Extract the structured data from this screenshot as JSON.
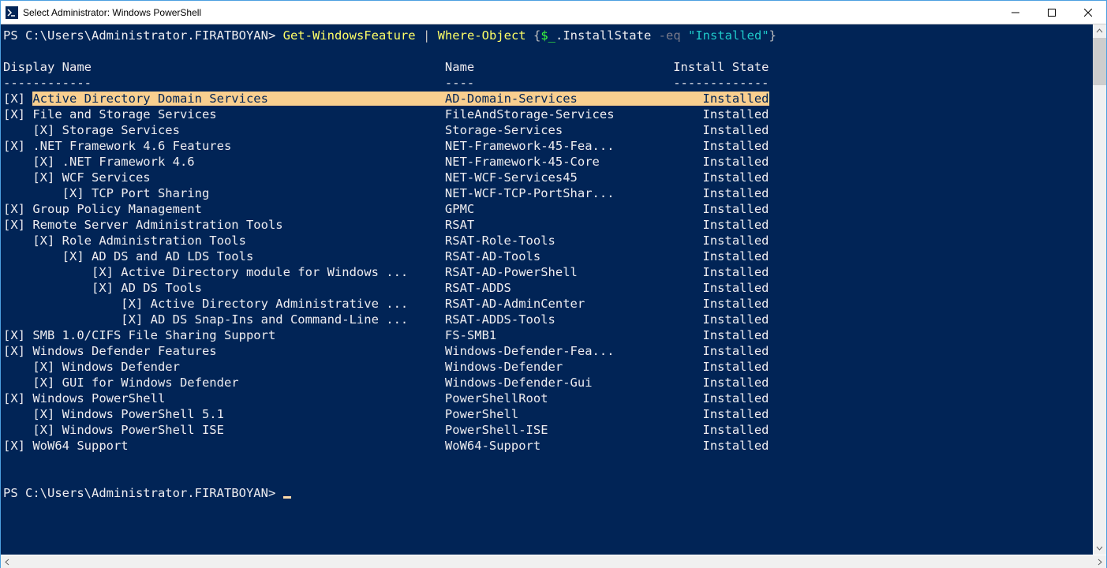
{
  "window": {
    "title": "Select Administrator: Windows PowerShell"
  },
  "prompt": {
    "label": "PS",
    "path": "C:\\Users\\Administrator.FIRATBOYAN",
    "cmd1": "Get-WindowsFeature",
    "pipe": "|",
    "cmd2": "Where-Object",
    "lbrace": "{",
    "curr": "$_",
    "prop": ".InstallState",
    "param": "-eq",
    "string": "\"Installed\"",
    "rbrace": "}"
  },
  "columns": {
    "display": "Display Name",
    "name": "Name",
    "install": "Install State",
    "dash_display": "------------",
    "dash_name": "----",
    "dash_install": "-------------"
  },
  "features": [
    {
      "indent": 0,
      "display": "Active Directory Domain Services",
      "name": "AD-Domain-Services",
      "install": "Installed",
      "highlight": true
    },
    {
      "indent": 0,
      "display": "File and Storage Services",
      "name": "FileAndStorage-Services",
      "install": "Installed"
    },
    {
      "indent": 1,
      "display": "Storage Services",
      "name": "Storage-Services",
      "install": "Installed"
    },
    {
      "indent": 0,
      "display": ".NET Framework 4.6 Features",
      "name": "NET-Framework-45-Fea...",
      "install": "Installed"
    },
    {
      "indent": 1,
      "display": ".NET Framework 4.6",
      "name": "NET-Framework-45-Core",
      "install": "Installed"
    },
    {
      "indent": 1,
      "display": "WCF Services",
      "name": "NET-WCF-Services45",
      "install": "Installed"
    },
    {
      "indent": 2,
      "display": "TCP Port Sharing",
      "name": "NET-WCF-TCP-PortShar...",
      "install": "Installed"
    },
    {
      "indent": 0,
      "display": "Group Policy Management",
      "name": "GPMC",
      "install": "Installed"
    },
    {
      "indent": 0,
      "display": "Remote Server Administration Tools",
      "name": "RSAT",
      "install": "Installed"
    },
    {
      "indent": 1,
      "display": "Role Administration Tools",
      "name": "RSAT-Role-Tools",
      "install": "Installed"
    },
    {
      "indent": 2,
      "display": "AD DS and AD LDS Tools",
      "name": "RSAT-AD-Tools",
      "install": "Installed"
    },
    {
      "indent": 3,
      "display": "Active Directory module for Windows ...",
      "name": "RSAT-AD-PowerShell",
      "install": "Installed"
    },
    {
      "indent": 3,
      "display": "AD DS Tools",
      "name": "RSAT-ADDS",
      "install": "Installed"
    },
    {
      "indent": 4,
      "display": "Active Directory Administrative ...",
      "name": "RSAT-AD-AdminCenter",
      "install": "Installed"
    },
    {
      "indent": 4,
      "display": "AD DS Snap-Ins and Command-Line ...",
      "name": "RSAT-ADDS-Tools",
      "install": "Installed"
    },
    {
      "indent": 0,
      "display": "SMB 1.0/CIFS File Sharing Support",
      "name": "FS-SMB1",
      "install": "Installed"
    },
    {
      "indent": 0,
      "display": "Windows Defender Features",
      "name": "Windows-Defender-Fea...",
      "install": "Installed"
    },
    {
      "indent": 1,
      "display": "Windows Defender",
      "name": "Windows-Defender",
      "install": "Installed"
    },
    {
      "indent": 1,
      "display": "GUI for Windows Defender",
      "name": "Windows-Defender-Gui",
      "install": "Installed"
    },
    {
      "indent": 0,
      "display": "Windows PowerShell",
      "name": "PowerShellRoot",
      "install": "Installed"
    },
    {
      "indent": 1,
      "display": "Windows PowerShell 5.1",
      "name": "PowerShell",
      "install": "Installed"
    },
    {
      "indent": 1,
      "display": "Windows PowerShell ISE",
      "name": "PowerShell-ISE",
      "install": "Installed"
    },
    {
      "indent": 0,
      "display": "WoW64 Support",
      "name": "WoW64-Support",
      "install": "Installed"
    }
  ],
  "layout": {
    "col_name": 60,
    "col_install_end": 104
  }
}
